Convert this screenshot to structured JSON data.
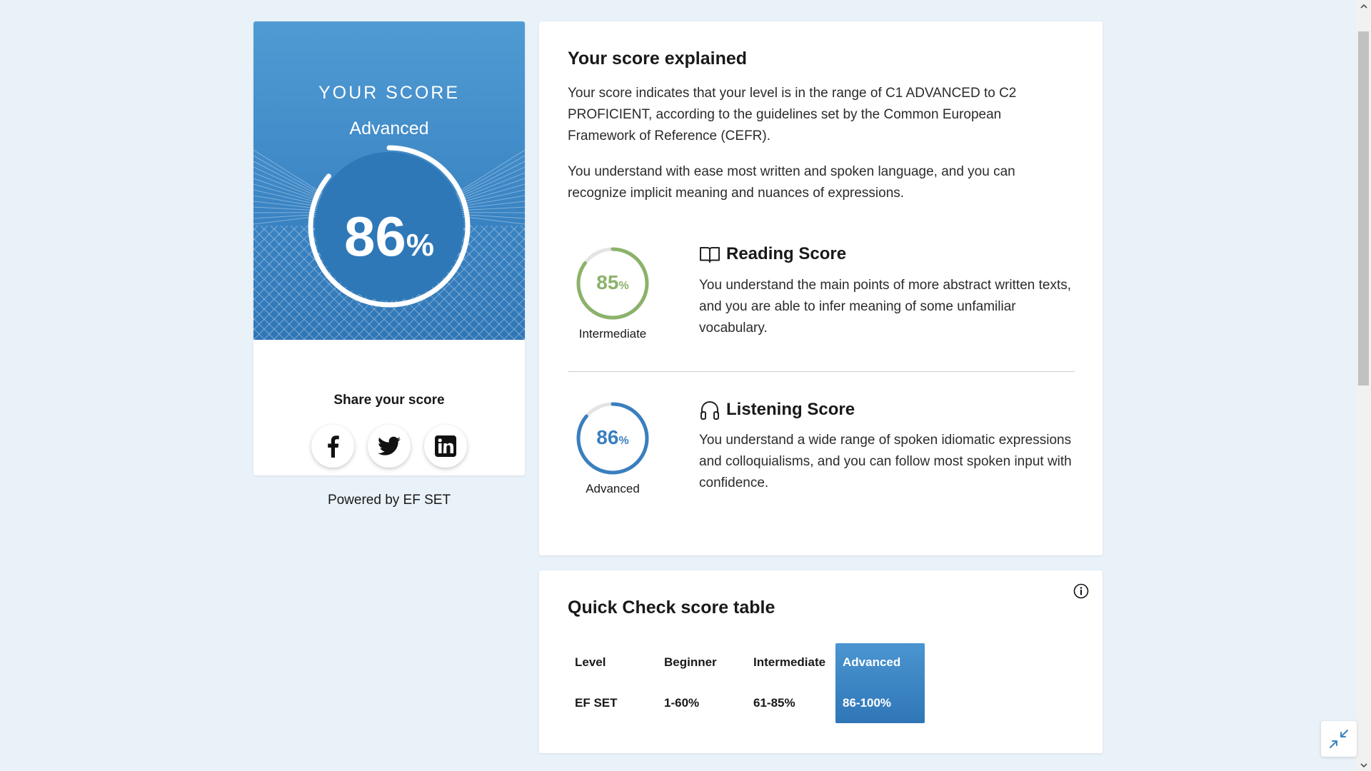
{
  "score_card": {
    "title": "YOUR SCORE",
    "level": "Advanced",
    "score": 86,
    "score_num": "86",
    "score_unit": "%",
    "share_title": "Share your score",
    "share_buttons": [
      "facebook-icon",
      "twitter-icon",
      "linkedin-icon"
    ],
    "accent_color": "#3a84c3"
  },
  "powered_by": "Powered by EF SET",
  "explained": {
    "title": "Your score explained",
    "paragraph_1": "Your score indicates that your level is in the range of C1 ADVANCED to C2 PROFICIENT, according to the guidelines set by the Common European Framework of Reference (CEFR).",
    "paragraph_2": "You understand with ease most written and spoken language, and you can recognize implicit meaning and nuances of expressions.",
    "reading": {
      "icon": "book-icon",
      "heading": "Reading Score",
      "score": 85,
      "score_num": "85",
      "score_unit": "%",
      "level": "Intermediate",
      "color": "#8bb26a",
      "description": "You understand the main points of more abstract written texts, and you are able to infer meaning of some unfamiliar vocabulary."
    },
    "listening": {
      "icon": "headphones-icon",
      "heading": "Listening Score",
      "score": 86,
      "score_num": "86",
      "score_unit": "%",
      "level": "Advanced",
      "color": "#3a7fbe",
      "description": "You understand a wide range of spoken idiomatic expressions and colloquialisms, and you can follow most spoken input with confidence."
    }
  },
  "quick_check": {
    "title": "Quick Check score table",
    "info_icon": "info-icon",
    "columns": [
      {
        "head": "Level",
        "value": "EF SET",
        "active": false
      },
      {
        "head": "Beginner",
        "value": "1-60%",
        "active": false
      },
      {
        "head": "Intermediate",
        "value": "61-85%",
        "active": false
      },
      {
        "head": "Advanced",
        "value": "86-100%",
        "active": true
      }
    ]
  }
}
